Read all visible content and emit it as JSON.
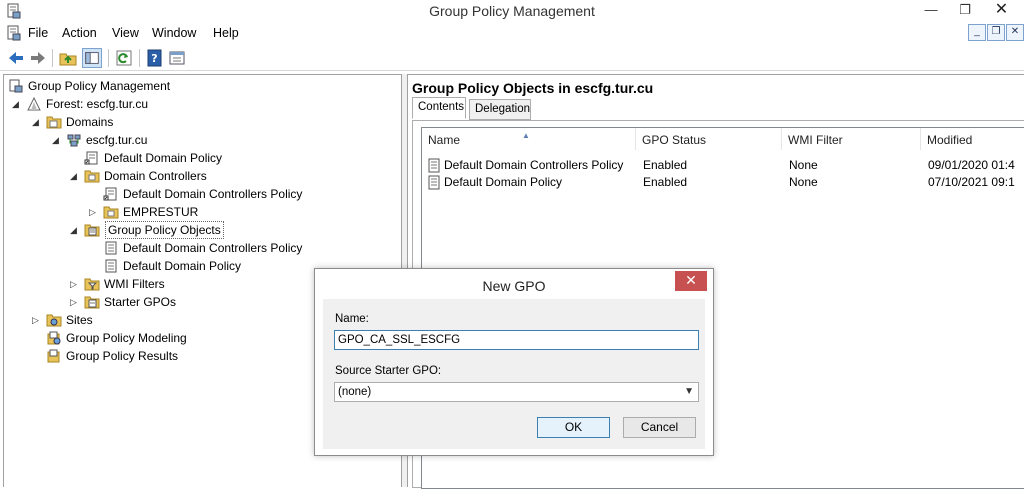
{
  "window": {
    "title": "Group Policy Management",
    "minimize": "—",
    "maximize": "❐",
    "close": "✕"
  },
  "menu": [
    "File",
    "Action",
    "View",
    "Window",
    "Help"
  ],
  "tree": {
    "root": "Group Policy Management",
    "forest": "Forest: escfg.tur.cu",
    "domains": "Domains",
    "domain": "escfg.tur.cu",
    "default_domain_policy": "Default Domain Policy",
    "domain_controllers": "Domain Controllers",
    "ddc_policy_link": "Default Domain Controllers Policy",
    "emprestur": "EMPRESTUR",
    "gpo_container": "Group Policy Objects",
    "gpo_ddc_policy": "Default Domain Controllers Policy",
    "gpo_dd_policy": "Default Domain Policy",
    "wmi_filters": "WMI Filters",
    "starter_gpos": "Starter GPOs",
    "sites": "Sites",
    "modeling": "Group Policy Modeling",
    "results": "Group Policy Results"
  },
  "right": {
    "title": "Group Policy Objects in escfg.tur.cu",
    "tabs": [
      "Contents",
      "Delegation"
    ],
    "columns": [
      "Name",
      "GPO Status",
      "WMI Filter",
      "Modified"
    ],
    "rows": [
      {
        "name": "Default Domain Controllers Policy",
        "status": "Enabled",
        "wmi": "None",
        "modified": "09/01/2020 01:4"
      },
      {
        "name": "Default Domain Policy",
        "status": "Enabled",
        "wmi": "None",
        "modified": "07/10/2021 09:1"
      }
    ]
  },
  "dialog": {
    "title": "New GPO",
    "close": "✕",
    "name_label": "Name:",
    "name_value": "GPO_CA_SSL_ESCFG",
    "starter_label": "Source Starter GPO:",
    "starter_value": "(none)",
    "ok": "OK",
    "cancel": "Cancel"
  },
  "colors": {
    "accent_blue": "#3c7fb1",
    "close_red": "#c75050",
    "folder_yellow": "#e8c35a"
  }
}
